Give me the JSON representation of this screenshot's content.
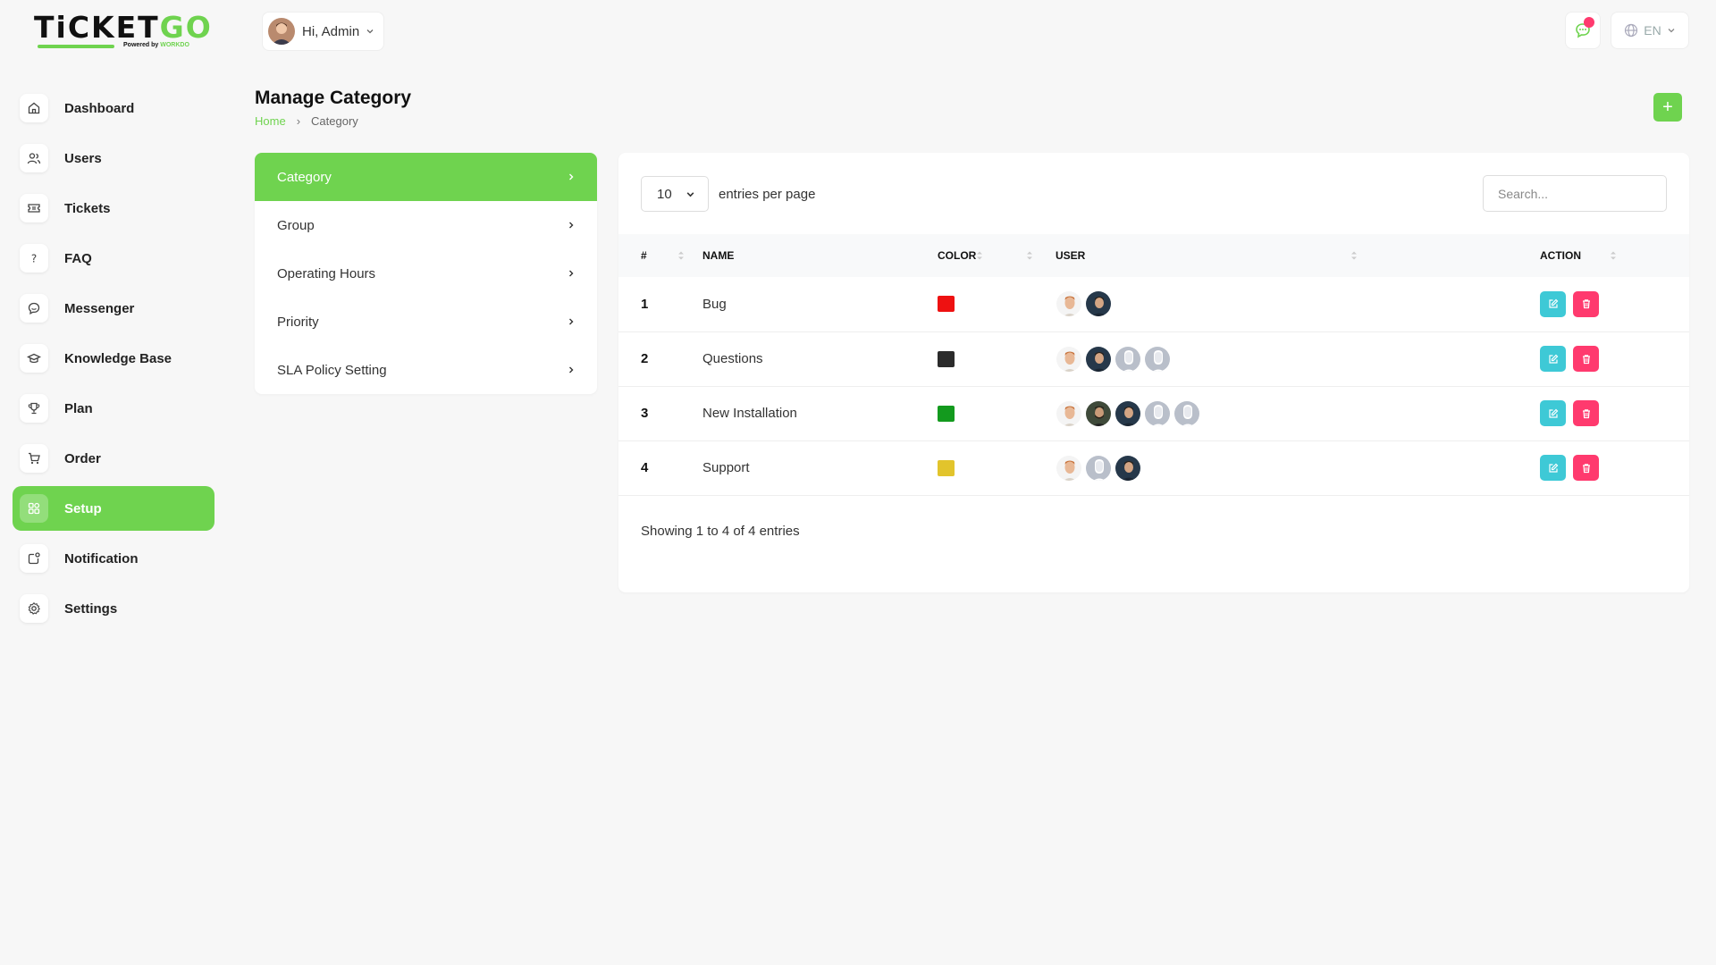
{
  "brand": {
    "name_main": "TiCKET",
    "name_accent": "GO",
    "powered_by": "Powered by",
    "powered_brand": "WORKDO"
  },
  "header": {
    "greeting": "Hi, Admin",
    "language": "EN"
  },
  "sidebar": {
    "items": [
      {
        "label": "Dashboard",
        "icon": "home-icon",
        "active": false
      },
      {
        "label": "Users",
        "icon": "users-icon",
        "active": false
      },
      {
        "label": "Tickets",
        "icon": "ticket-icon",
        "active": false
      },
      {
        "label": "FAQ",
        "icon": "question-icon",
        "active": false
      },
      {
        "label": "Messenger",
        "icon": "chat-icon",
        "active": false
      },
      {
        "label": "Knowledge Base",
        "icon": "graduation-cap-icon",
        "active": false
      },
      {
        "label": "Plan",
        "icon": "trophy-icon",
        "active": false
      },
      {
        "label": "Order",
        "icon": "cart-icon",
        "active": false
      },
      {
        "label": "Setup",
        "icon": "grid-icon",
        "active": true
      },
      {
        "label": "Notification",
        "icon": "notification-icon",
        "active": false
      },
      {
        "label": "Settings",
        "icon": "gear-icon",
        "active": false
      }
    ]
  },
  "page": {
    "title": "Manage Category",
    "breadcrumb_home": "Home",
    "breadcrumb_current": "Category",
    "add_label": "+"
  },
  "submenu": {
    "items": [
      {
        "label": "Category",
        "active": true
      },
      {
        "label": "Group",
        "active": false
      },
      {
        "label": "Operating Hours",
        "active": false
      },
      {
        "label": "Priority",
        "active": false
      },
      {
        "label": "SLA Policy Setting",
        "active": false
      }
    ]
  },
  "table": {
    "entries_value": "10",
    "entries_label": "entries per page",
    "search_placeholder": "Search...",
    "columns": {
      "num": "#",
      "name": "NAME",
      "color": "COLOR",
      "user": "USER",
      "action": "ACTION"
    },
    "rows": [
      {
        "num": "1",
        "name": "Bug",
        "color": "#ee1111",
        "users": [
          "face-light",
          "face-dark"
        ]
      },
      {
        "num": "2",
        "name": "Questions",
        "color": "#2b2b2b",
        "users": [
          "face-light",
          "face-dark",
          "placeholder",
          "placeholder"
        ]
      },
      {
        "num": "3",
        "name": "New Installation",
        "color": "#139a1e",
        "users": [
          "face-light",
          "face-beard",
          "face-dark",
          "placeholder",
          "placeholder"
        ]
      },
      {
        "num": "4",
        "name": "Support",
        "color": "#e2c42c",
        "users": [
          "face-light",
          "placeholder",
          "face-dark"
        ]
      }
    ],
    "footer": "Showing 1 to 4 of 4 entries"
  },
  "colors": {
    "accent": "#6fd34f",
    "edit": "#3ec9d6",
    "delete": "#ff3a6e"
  }
}
